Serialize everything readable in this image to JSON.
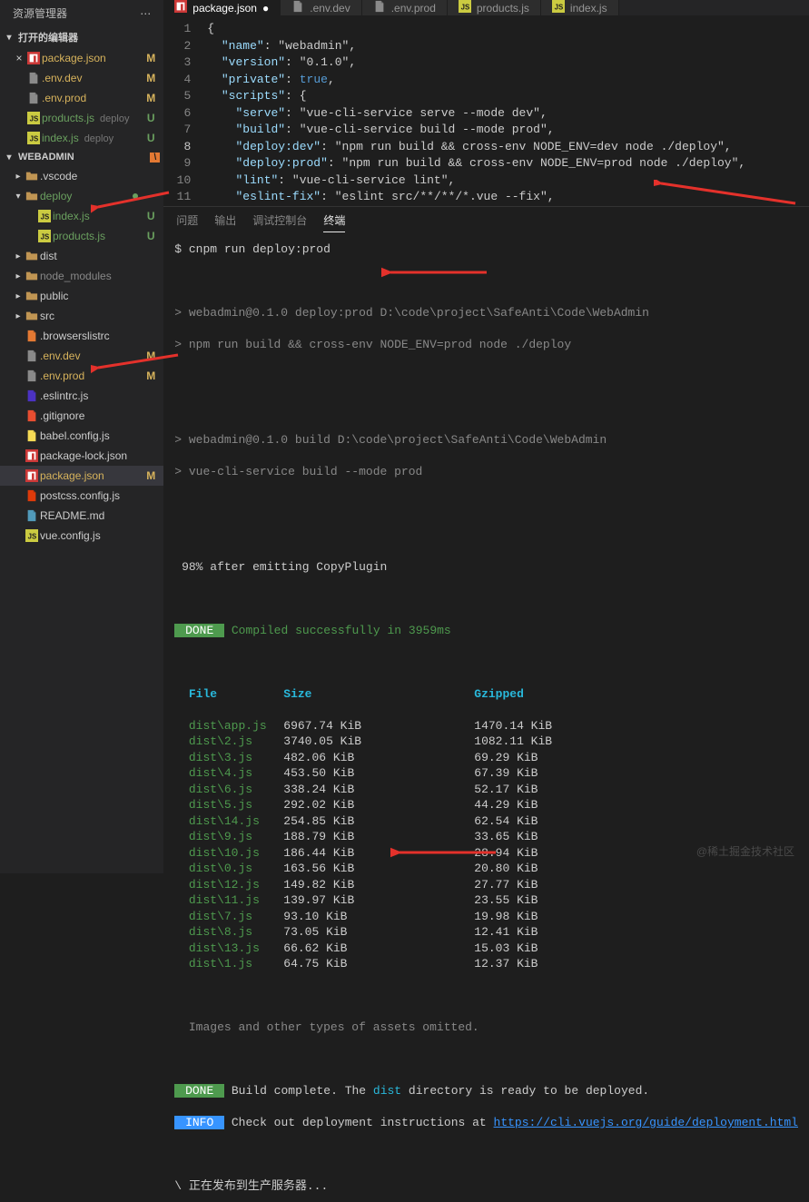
{
  "sidebar": {
    "title": "资源管理器",
    "openEditors": {
      "label": "打开的编辑器",
      "items": [
        {
          "icon": "npm",
          "name": "package.json",
          "status": "M",
          "closeable": true,
          "yellow": true
        },
        {
          "icon": "file",
          "name": ".env.dev",
          "status": "M",
          "yellow": true
        },
        {
          "icon": "file",
          "name": ".env.prod",
          "status": "M",
          "yellow": true
        },
        {
          "icon": "js",
          "name": "products.js",
          "hint": "deploy",
          "status": "U",
          "green": true
        },
        {
          "icon": "js",
          "name": "index.js",
          "hint": "deploy",
          "status": "U",
          "green": true
        }
      ]
    },
    "project": {
      "label": "WEBADMIN",
      "badge": "\\",
      "items": [
        {
          "exp": "▸",
          "icon": "folder",
          "name": ".vscode",
          "indent": 0
        },
        {
          "exp": "▾",
          "icon": "folder",
          "name": "deploy",
          "indent": 0,
          "dot": true,
          "green": true
        },
        {
          "icon": "js",
          "name": "index.js",
          "indent": 1,
          "status": "U",
          "green": true
        },
        {
          "icon": "js",
          "name": "products.js",
          "indent": 1,
          "status": "U",
          "green": true
        },
        {
          "exp": "▸",
          "icon": "folder",
          "name": "dist",
          "indent": 0
        },
        {
          "exp": "▸",
          "icon": "folder",
          "name": "node_modules",
          "indent": 0,
          "dim": true
        },
        {
          "exp": "▸",
          "icon": "folder",
          "name": "public",
          "indent": 0
        },
        {
          "exp": "▸",
          "icon": "folder",
          "name": "src",
          "indent": 0
        },
        {
          "icon": "browserslist",
          "name": ".browserslistrc",
          "indent": 0
        },
        {
          "icon": "file",
          "name": ".env.dev",
          "indent": 0,
          "status": "M",
          "yellow": true
        },
        {
          "icon": "file",
          "name": ".env.prod",
          "indent": 0,
          "status": "M",
          "yellow": true
        },
        {
          "icon": "eslint",
          "name": ".eslintrc.js",
          "indent": 0
        },
        {
          "icon": "git",
          "name": ".gitignore",
          "indent": 0
        },
        {
          "icon": "babel",
          "name": "babel.config.js",
          "indent": 0
        },
        {
          "icon": "npm",
          "name": "package-lock.json",
          "indent": 0
        },
        {
          "icon": "npm",
          "name": "package.json",
          "indent": 0,
          "status": "M",
          "yellow": true,
          "selected": true
        },
        {
          "icon": "postcss",
          "name": "postcss.config.js",
          "indent": 0
        },
        {
          "icon": "md",
          "name": "README.md",
          "indent": 0
        },
        {
          "icon": "js",
          "name": "vue.config.js",
          "indent": 0
        }
      ]
    }
  },
  "tabs": [
    {
      "icon": "npm",
      "label": "package.json",
      "active": true,
      "dirty": true
    },
    {
      "icon": "file",
      "label": ".env.dev"
    },
    {
      "icon": "file",
      "label": ".env.prod"
    },
    {
      "icon": "js",
      "label": "products.js"
    },
    {
      "icon": "js",
      "label": "index.js"
    }
  ],
  "editor": {
    "lines": [
      {
        "n": 1,
        "t": "{"
      },
      {
        "n": 2,
        "t": "  \"name\": \"webadmin\","
      },
      {
        "n": 3,
        "t": "  \"version\": \"0.1.0\","
      },
      {
        "n": 4,
        "t": "  \"private\": true,"
      },
      {
        "n": 5,
        "t": "  \"scripts\": {"
      },
      {
        "n": 6,
        "t": "    \"serve\": \"vue-cli-service serve --mode dev\","
      },
      {
        "n": 7,
        "t": "    \"build\": \"vue-cli-service build --mode prod\","
      },
      {
        "n": 8,
        "hl": true,
        "t": "    \"deploy:dev\": \"npm run build && cross-env NODE_ENV=dev node ./deploy\","
      },
      {
        "n": 9,
        "t": "    \"deploy:prod\": \"npm run build && cross-env NODE_ENV=prod node ./deploy\","
      },
      {
        "n": 10,
        "t": "    \"lint\": \"vue-cli-service lint\","
      },
      {
        "n": 11,
        "t": "    \"eslint-fix\": \"eslint src/**/**/*.vue --fix\","
      }
    ]
  },
  "panel": {
    "tabs": [
      "问题",
      "输出",
      "调试控制台",
      "终端"
    ],
    "active": 3,
    "cmd": "$ cnpm run deploy:prod",
    "out1a": "> webadmin@0.1.0 deploy:prod D:\\code\\project\\SafeAnti\\Code\\WebAdmin",
    "out1b": "> npm run build && cross-env NODE_ENV=prod node ./deploy",
    "out2a": "> webadmin@0.1.0 build D:\\code\\project\\SafeAnti\\Code\\WebAdmin",
    "out2b": "> vue-cli-service build --mode prod",
    "progress": " 98% after emitting CopyPlugin",
    "done1": " DONE ",
    "done1msg": " Compiled successfully in 3959ms",
    "tableHeader": {
      "file": "File",
      "size": "Size",
      "gzip": "Gzipped"
    },
    "rows": [
      {
        "f": "dist\\app.js",
        "s": "6967.74 KiB",
        "g": "1470.14 KiB"
      },
      {
        "f": "dist\\2.js",
        "s": "3740.05 KiB",
        "g": "1082.11 KiB"
      },
      {
        "f": "dist\\3.js",
        "s": "482.06 KiB",
        "g": "69.29 KiB"
      },
      {
        "f": "dist\\4.js",
        "s": "453.50 KiB",
        "g": "67.39 KiB"
      },
      {
        "f": "dist\\6.js",
        "s": "338.24 KiB",
        "g": "52.17 KiB"
      },
      {
        "f": "dist\\5.js",
        "s": "292.02 KiB",
        "g": "44.29 KiB"
      },
      {
        "f": "dist\\14.js",
        "s": "254.85 KiB",
        "g": "62.54 KiB"
      },
      {
        "f": "dist\\9.js",
        "s": "188.79 KiB",
        "g": "33.65 KiB"
      },
      {
        "f": "dist\\10.js",
        "s": "186.44 KiB",
        "g": "28.94 KiB"
      },
      {
        "f": "dist\\0.js",
        "s": "163.56 KiB",
        "g": "20.80 KiB"
      },
      {
        "f": "dist\\12.js",
        "s": "149.82 KiB",
        "g": "27.77 KiB"
      },
      {
        "f": "dist\\11.js",
        "s": "139.97 KiB",
        "g": "23.55 KiB"
      },
      {
        "f": "dist\\7.js",
        "s": "93.10 KiB",
        "g": "19.98 KiB"
      },
      {
        "f": "dist\\8.js",
        "s": "73.05 KiB",
        "g": "12.41 KiB"
      },
      {
        "f": "dist\\13.js",
        "s": "66.62 KiB",
        "g": "15.03 KiB"
      },
      {
        "f": "dist\\1.js",
        "s": "64.75 KiB",
        "g": "12.37 KiB"
      }
    ],
    "omitted": "  Images and other types of assets omitted.",
    "done2": " DONE ",
    "done2msg_a": " Build complete. The ",
    "done2msg_b": "dist",
    "done2msg_c": " directory is ready to be deployed.",
    "info": " INFO ",
    "infomsg": " Check out deployment instructions at ",
    "infolink": "https://cli.vuejs.org/guide/deployment.html",
    "publishing": "\\ 正在发布到生产服务器..."
  },
  "watermark": "@稀土掘金技术社区"
}
